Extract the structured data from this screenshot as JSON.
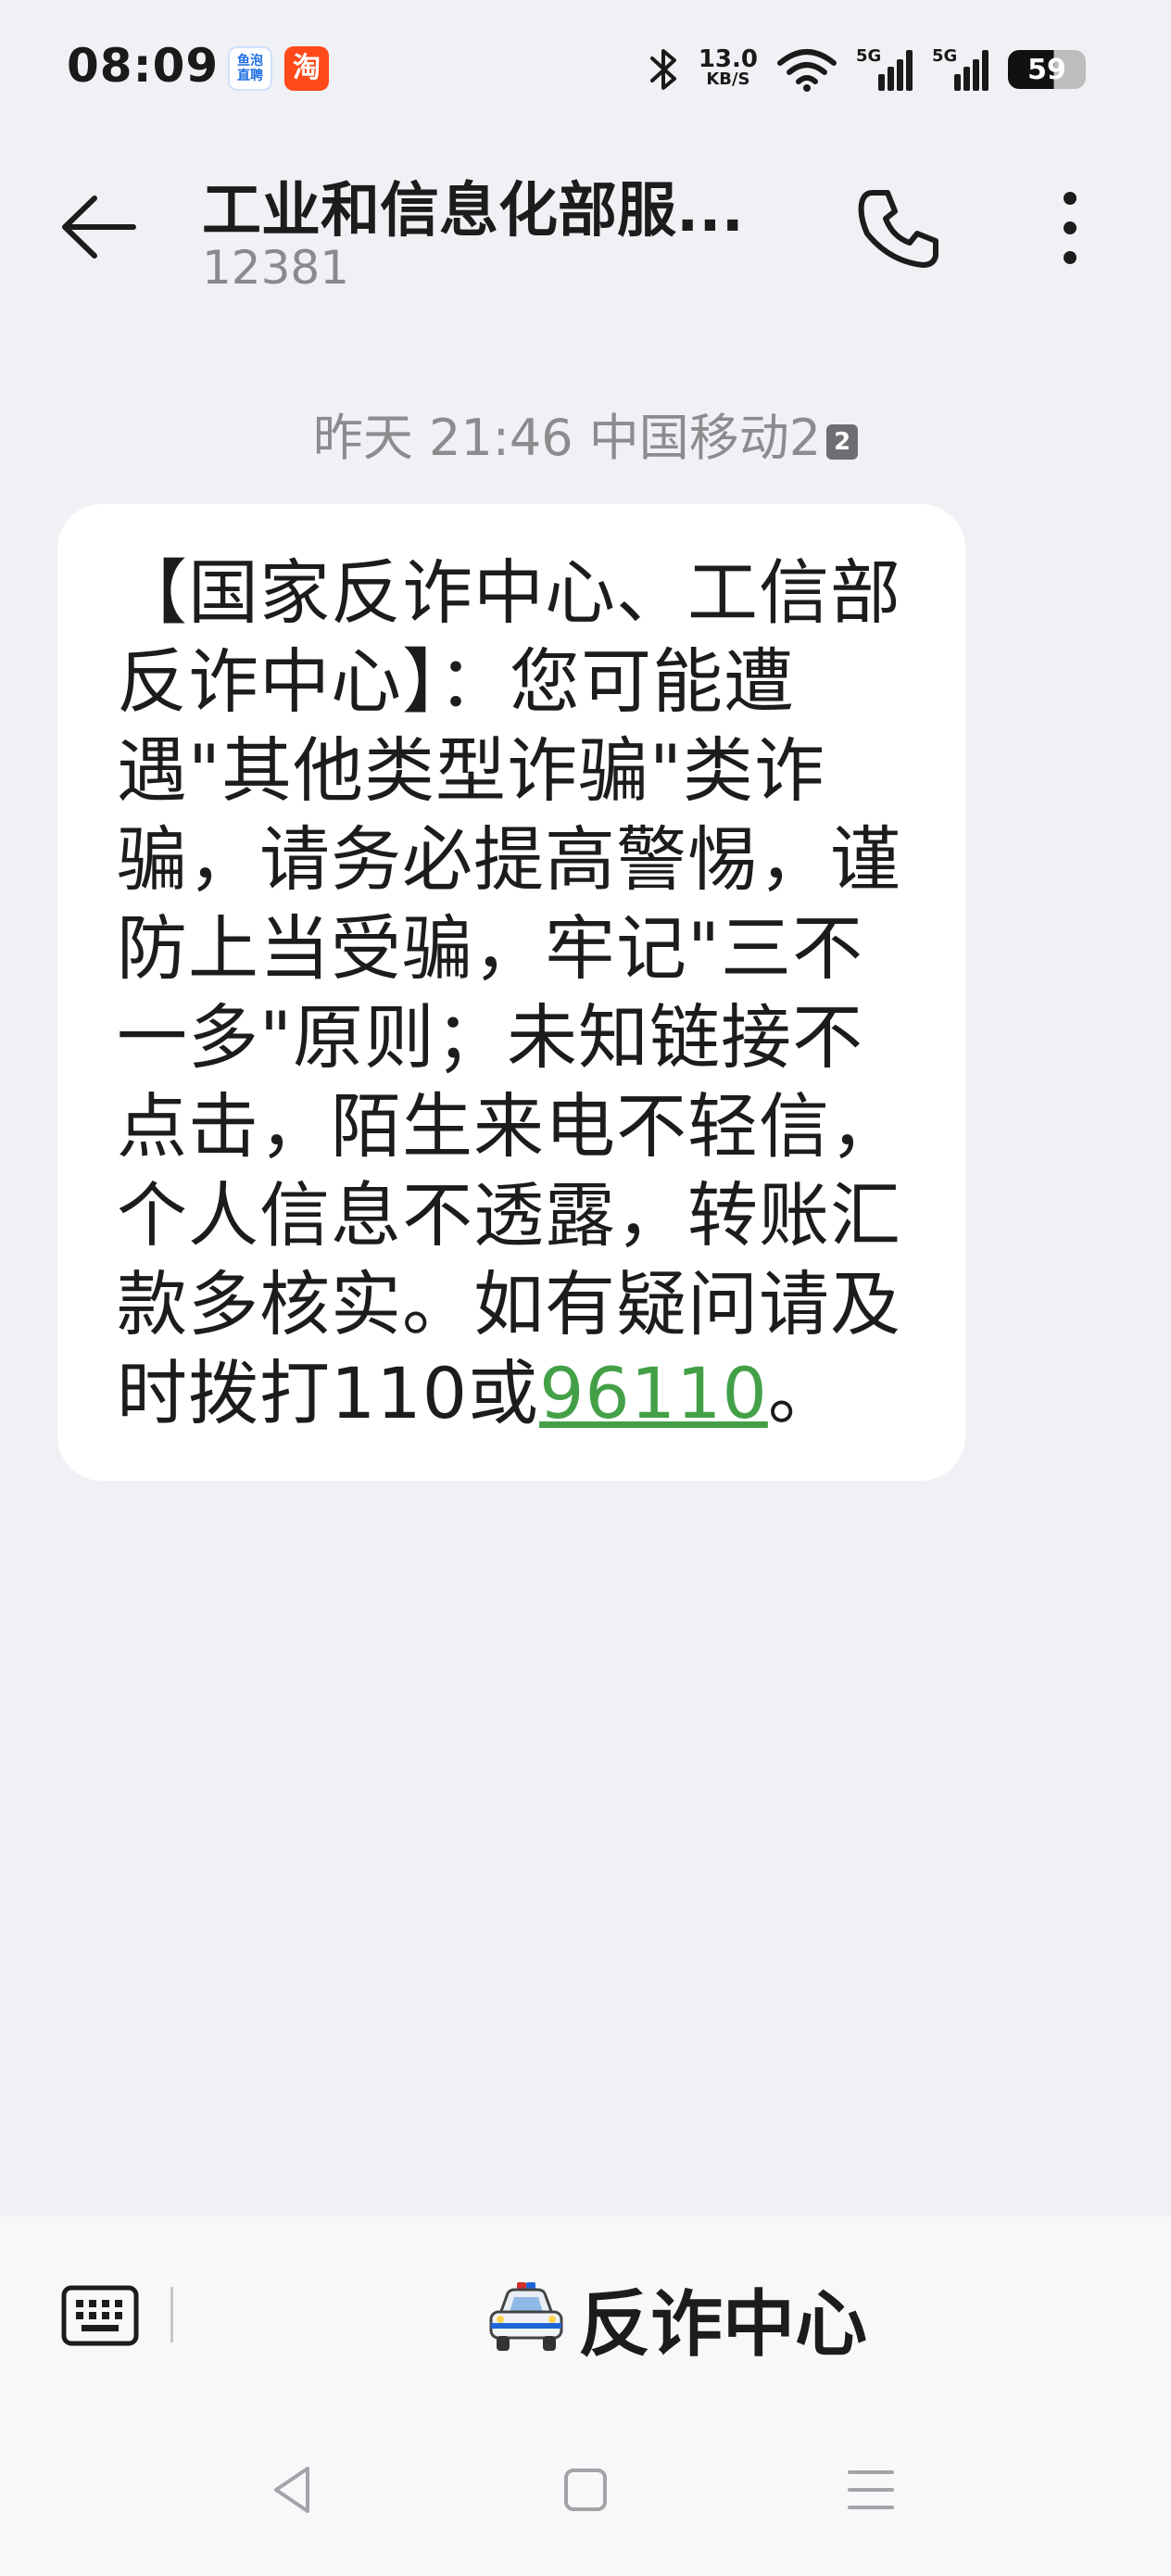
{
  "status_bar": {
    "time": "08:09",
    "apps": {
      "douyu": "鱼泡直聘",
      "taobao": "淘"
    },
    "net_speed": "13.0",
    "net_unit": "KB/S",
    "sim1_tag": "5G",
    "sim2_tag": "5G",
    "battery": "59"
  },
  "header": {
    "contact_name": "工业和信息化部服...",
    "contact_number": "12381",
    "icons": {
      "back": "arrow-left-icon",
      "call": "phone-icon",
      "more": "more-vertical-icon"
    }
  },
  "conversation": {
    "timestamp": "昨天 21:46 中国移动2",
    "sim_badge": "2",
    "message": {
      "text_before_link": "【国家反诈中心、工信部反诈中心】：您可能遭遇\"其他类型诈骗\"类诈骗，请务必提高警惕，谨防上当受骗，牢记\"三不一多\"原则；未知链接不点击，陌生来电不轻信，个人信息不透露，转账汇款多核实。如有疑问请及时拨打110或",
      "link_text": "96110",
      "text_after_link": "。",
      "link_color": "#43a047"
    }
  },
  "bottom_bar": {
    "menu_label": "反诈中心",
    "icons": {
      "keyboard": "keyboard-icon",
      "menu": "police-car-icon"
    }
  },
  "nav_bar": {
    "icons": [
      "nav-back-icon",
      "nav-home-icon",
      "nav-recents-icon"
    ]
  }
}
